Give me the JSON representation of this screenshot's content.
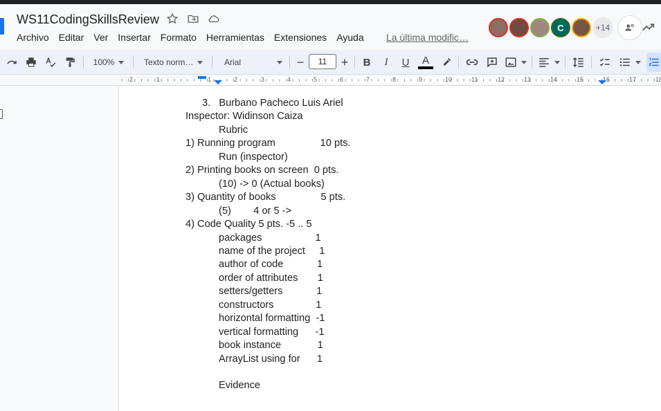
{
  "doc": {
    "title": "WS11CodingSkillsReview",
    "last_modified": "La última modific…"
  },
  "menu": [
    "Archivo",
    "Editar",
    "Ver",
    "Insertar",
    "Formato",
    "Herramientas",
    "Extensiones",
    "Ayuda"
  ],
  "collaborators": {
    "avatars": [
      {
        "initial": "",
        "color": "#8d6e63",
        "ring": "#d93025"
      },
      {
        "initial": "",
        "color": "#6d4c41",
        "ring": "#d93025"
      },
      {
        "initial": "",
        "color": "#a1887f",
        "ring": "#7cb342"
      },
      {
        "initial": "C",
        "color": "#00695c",
        "ring": "#33691e"
      },
      {
        "initial": "",
        "color": "#795548",
        "ring": "#f9ab00"
      }
    ],
    "more_count": "+14"
  },
  "toolbar": {
    "zoom": "100%",
    "style": "Texto norm…",
    "font": "Arial",
    "font_size": "11"
  },
  "ruler": [
    "2",
    "1",
    "1",
    "2",
    "3",
    "4",
    "5",
    "6",
    "7",
    "8",
    "9",
    "10",
    "11",
    "12",
    "13",
    "14",
    "15",
    "16",
    "17",
    "18"
  ],
  "body_lines": [
    {
      "text": "3.   Burbano Pacheco Luis Ariel",
      "indent": 1
    },
    {
      "text": "Inspector: Widinson Caiza",
      "indent": 0
    },
    {
      "text": "Rubric",
      "indent": 2
    },
    {
      "text": "1) Running program                10 pts.",
      "indent": 0
    },
    {
      "text": "Run (inspector)",
      "indent": 2
    },
    {
      "text": "2) Printing books on screen  0 pts.",
      "indent": 0
    },
    {
      "text": "(10) -> 0 (Actual books)",
      "indent": 2
    },
    {
      "text": "3) Quantity of books                5 pts.",
      "indent": 0
    },
    {
      "text": "(5)        4 or 5 ->",
      "indent": 2
    },
    {
      "text": "4) Code Quality 5 pts. -5 .. 5",
      "indent": 0
    },
    {
      "text": "packages                   1",
      "indent": 2
    },
    {
      "text": "name of the project     1",
      "indent": 2
    },
    {
      "text": "author of code            1",
      "indent": 2
    },
    {
      "text": "order of attributes       1",
      "indent": 2
    },
    {
      "text": "setters/getters            1",
      "indent": 2
    },
    {
      "text": "constructors               1",
      "indent": 2
    },
    {
      "text": "horizontal formatting  -1",
      "indent": 2
    },
    {
      "text": "vertical formatting      -1",
      "indent": 2
    },
    {
      "text": "book instance             1",
      "indent": 2
    },
    {
      "text": "ArrayList using for      1",
      "indent": 2
    },
    {
      "text": "",
      "indent": 2
    },
    {
      "text": "Evidence",
      "indent": 2
    }
  ]
}
